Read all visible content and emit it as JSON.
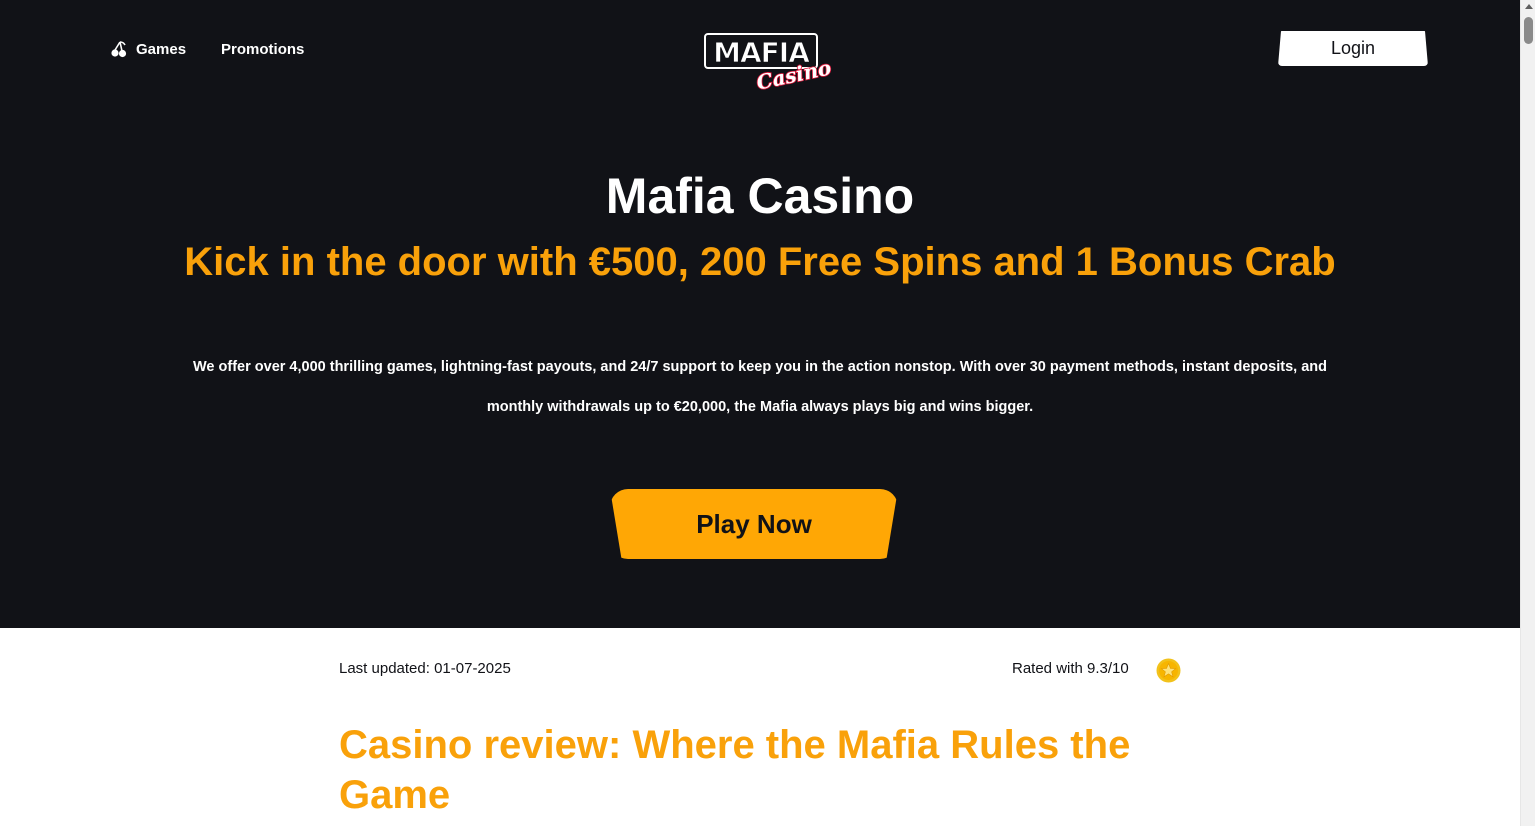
{
  "nav": {
    "games_label": "Games",
    "promotions_label": "Promotions",
    "login_label": "Login"
  },
  "logo": {
    "top_text": "MAFIA",
    "bottom_text": "Casino"
  },
  "hero": {
    "title": "Mafia Casino",
    "subtitle": "Kick in the door with €500, 200 Free Spins and 1 Bonus Crab",
    "description": "We offer over 4,000 thrilling games, lightning-fast payouts, and 24/7 support to keep you in the action nonstop. With over 30 payment methods, instant deposits, and monthly withdrawals up to €20,000, the Mafia always plays big and wins bigger.",
    "cta_label": "Play Now"
  },
  "review": {
    "last_updated": "Last updated: 01-07-2025",
    "rating": "Rated with 9.3/10",
    "heading": "Casino review: Where the Mafia Rules the Game"
  },
  "colors": {
    "hero_bg": "#111217",
    "accent": "#f9a10a",
    "button_accent": "#ffa705",
    "logo_red": "#e0183c"
  },
  "icons": {
    "games": "cherry-icon",
    "rating": "star-icon"
  }
}
